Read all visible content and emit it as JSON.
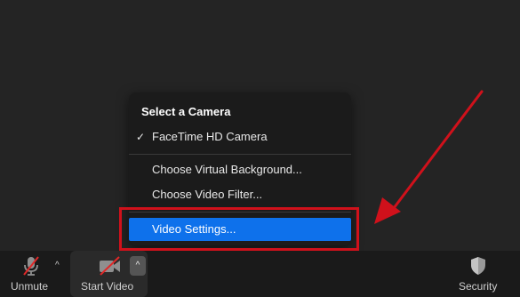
{
  "menu": {
    "title": "Select a Camera",
    "camera": {
      "label": "FaceTime HD Camera",
      "checked": true,
      "check_glyph": "✓"
    },
    "items": [
      {
        "label": "Choose Virtual Background..."
      },
      {
        "label": "Choose Video Filter..."
      }
    ],
    "selected_item": {
      "label": "Video Settings..."
    },
    "accent_color": "#0e71eb"
  },
  "annotation": {
    "box_color": "#d0111b",
    "arrow_color": "#d0111b"
  },
  "toolbar": {
    "unmute_label": "Unmute",
    "start_video_label": "Start Video",
    "security_label": "Security",
    "caret_glyph": "^",
    "icons": [
      "microphone-muted-icon",
      "video-camera-off-icon",
      "shield-icon"
    ]
  }
}
